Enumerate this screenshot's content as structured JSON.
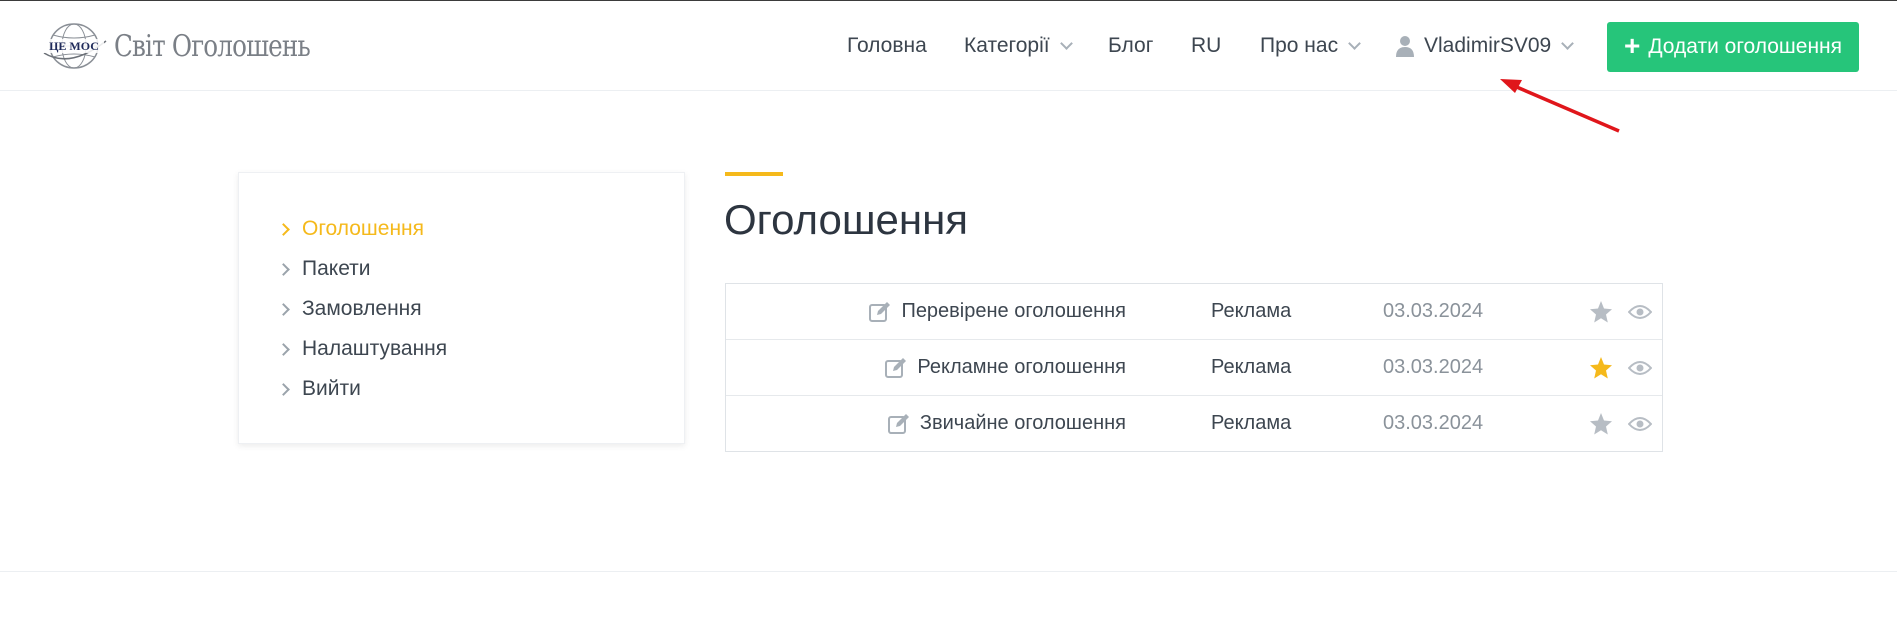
{
  "brand": {
    "logo_text": "Світ Оголошень",
    "logo_badge": "ЦЕ МОС"
  },
  "nav": {
    "home": "Головна",
    "categories": "Категорії",
    "blog": "Блог",
    "lang": "RU",
    "about": "Про нас",
    "user": "VladimirSV09",
    "add_button": "Додати оголошення"
  },
  "sidebar": {
    "items": [
      {
        "label": "Оголошення",
        "active": true
      },
      {
        "label": "Пакети",
        "active": false
      },
      {
        "label": "Замовлення",
        "active": false
      },
      {
        "label": "Налаштування",
        "active": false
      },
      {
        "label": "Вийти",
        "active": false
      }
    ]
  },
  "main": {
    "title": "Оголошення",
    "rows": [
      {
        "title": "Перевірене оголошення",
        "category": "Реклама",
        "date": "03.03.2024",
        "starred": false
      },
      {
        "title": "Рекламне оголошення",
        "category": "Реклама",
        "date": "03.03.2024",
        "starred": true
      },
      {
        "title": "Звичайне оголошення",
        "category": "Реклама",
        "date": "03.03.2024",
        "starred": false
      }
    ]
  },
  "colors": {
    "accent": "#f5b91b",
    "button": "#26c57a",
    "arrow": "#e0161b",
    "star_inactive": "#b7bdc4",
    "star_active": "#f5b91b"
  }
}
